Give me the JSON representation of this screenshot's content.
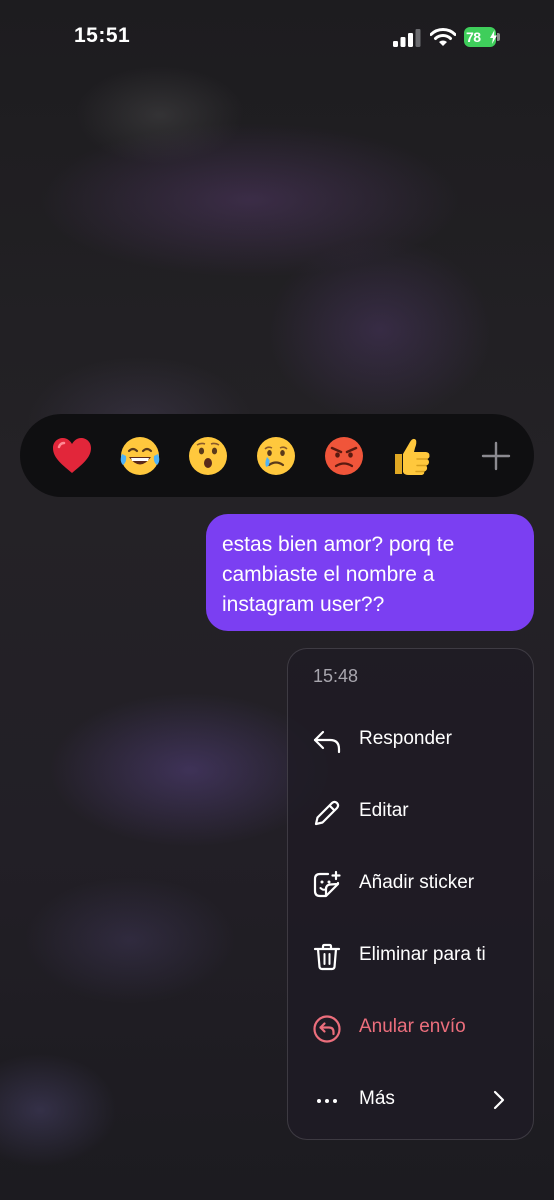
{
  "status_bar": {
    "time": "15:51",
    "battery_level": "78",
    "icons": [
      "cellular-signal-icon",
      "wifi-icon",
      "battery-charging-icon"
    ]
  },
  "reactions": {
    "emojis": [
      "❤️",
      "😂",
      "😮",
      "😢",
      "😡",
      "👍"
    ],
    "add_icon": "plus-icon"
  },
  "message": {
    "text": "estas bien amor? porq te cambiaste el nombre a instagram user??",
    "bubble_color": "#7b3ff2"
  },
  "context_menu": {
    "timestamp": "15:48",
    "items": [
      {
        "label": "Responder",
        "icon": "reply-icon"
      },
      {
        "label": "Editar",
        "icon": "pencil-icon"
      },
      {
        "label": "Añadir sticker",
        "icon": "add-sticker-icon"
      },
      {
        "label": "Eliminar para ti",
        "icon": "trash-icon"
      },
      {
        "label": "Anular envío",
        "icon": "unsend-icon",
        "color": "#ec6e7c"
      },
      {
        "label": "Más",
        "icon": "more-horizontal-icon",
        "trailing_icon": "chevron-right-icon"
      }
    ]
  }
}
